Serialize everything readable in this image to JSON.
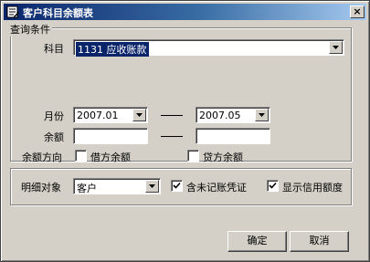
{
  "window": {
    "title": "客户科目余额表",
    "close_label": "×"
  },
  "query": {
    "group_title": "查询条件",
    "subject": {
      "label": "科目",
      "value": "1131 应收账款"
    },
    "month": {
      "label": "月份",
      "from": "2007.01",
      "to": "2007.05"
    },
    "balance": {
      "label": "余额",
      "from": "",
      "to": ""
    },
    "direction": {
      "label": "余额方向",
      "debit": {
        "label": "借方余额",
        "checked": false
      },
      "credit": {
        "label": "贷方余额",
        "checked": false
      }
    }
  },
  "detail": {
    "label": "明细对象",
    "object_value": "客户",
    "include_unposted": {
      "label": "含未记账凭证",
      "checked": true
    },
    "show_credit": {
      "label": "显示信用额度",
      "checked": true
    }
  },
  "buttons": {
    "ok_label": "确定",
    "cancel_label": "取消"
  },
  "icons": {
    "app": "document-icon",
    "close": "close-icon",
    "dropdown": "chevron-down-icon",
    "checkmark": "checkmark-icon"
  },
  "colors": {
    "title_start": "#0a246a",
    "title_end": "#a6caf0",
    "face": "#d4d0c8",
    "highlight": "#0a246a"
  }
}
